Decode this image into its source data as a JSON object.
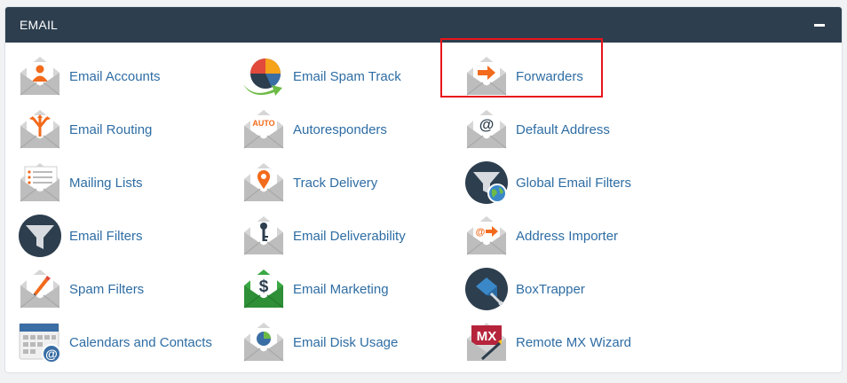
{
  "panel": {
    "title": "EMAIL",
    "collapse_icon": "minus-icon"
  },
  "items": [
    {
      "label": "Email Accounts",
      "icon": "email-accounts-icon"
    },
    {
      "label": "Email Spam Track",
      "icon": "spam-track-icon"
    },
    {
      "label": "Forwarders",
      "icon": "forwarders-icon"
    },
    {
      "label": "Email Routing",
      "icon": "email-routing-icon"
    },
    {
      "label": "Autoresponders",
      "icon": "autoresponders-icon",
      "badge": "AUTO"
    },
    {
      "label": "Default Address",
      "icon": "default-address-icon"
    },
    {
      "label": "Mailing Lists",
      "icon": "mailing-lists-icon"
    },
    {
      "label": "Track Delivery",
      "icon": "track-delivery-icon"
    },
    {
      "label": "Global Email Filters",
      "icon": "global-email-filters-icon"
    },
    {
      "label": "Email Filters",
      "icon": "email-filters-icon"
    },
    {
      "label": "Email Deliverability",
      "icon": "email-deliverability-icon"
    },
    {
      "label": "Address Importer",
      "icon": "address-importer-icon"
    },
    {
      "label": "Spam Filters",
      "icon": "spam-filters-icon"
    },
    {
      "label": "Email Marketing",
      "icon": "email-marketing-icon"
    },
    {
      "label": "BoxTrapper",
      "icon": "boxtrapper-icon"
    },
    {
      "label": "Calendars and Contacts",
      "icon": "calendars-contacts-icon"
    },
    {
      "label": "Email Disk Usage",
      "icon": "email-disk-usage-icon"
    },
    {
      "label": "Remote MX Wizard",
      "icon": "remote-mx-wizard-icon",
      "badge": "MX"
    }
  ],
  "highlighted_item": "Forwarders",
  "colors": {
    "header_bg": "#2d3e4e",
    "link": "#2e6da4",
    "accent_orange": "#f26a1b",
    "highlight_border": "#e8141b"
  }
}
